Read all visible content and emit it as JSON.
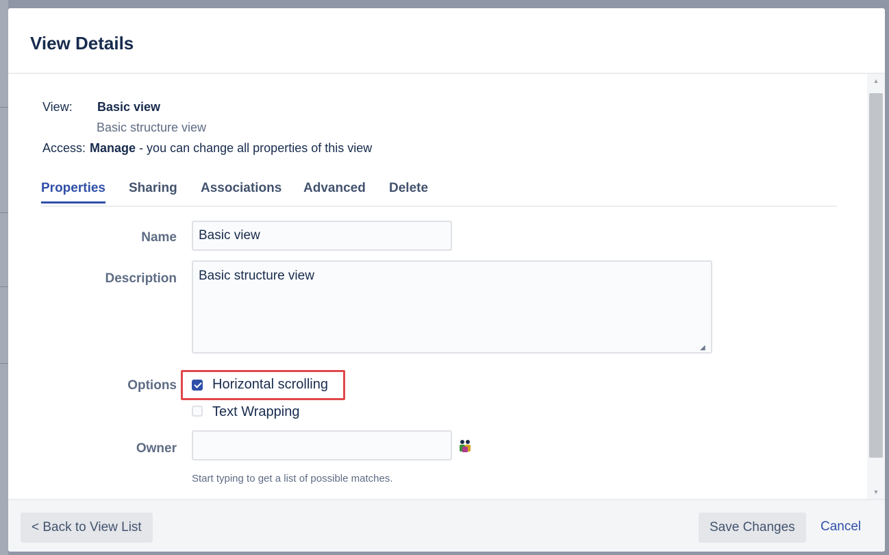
{
  "dialog": {
    "title": "View Details"
  },
  "info": {
    "view_label": "View:",
    "view_name": "Basic view",
    "view_description": "Basic structure view",
    "access_label": "Access:",
    "access_level": "Manage",
    "access_text": " - you can change all properties of this view"
  },
  "tabs": [
    {
      "label": "Properties",
      "active": true
    },
    {
      "label": "Sharing"
    },
    {
      "label": "Associations"
    },
    {
      "label": "Advanced"
    },
    {
      "label": "Delete"
    }
  ],
  "form": {
    "name_label": "Name",
    "name_value": "Basic view",
    "description_label": "Description",
    "description_value": "Basic structure view",
    "options_label": "Options",
    "option_horizontal": "Horizontal scrolling",
    "option_horizontal_checked": true,
    "option_wrapping": "Text Wrapping",
    "option_wrapping_checked": false,
    "owner_label": "Owner",
    "owner_value": "",
    "owner_hint": "Start typing to get a list of possible matches."
  },
  "footer": {
    "back_label": "< Back to View List",
    "save_label": "Save Changes",
    "cancel_label": "Cancel"
  },
  "icons": {
    "owner_picker": "user-picker-icon",
    "scroll_up": "scroll-up-arrow-icon",
    "scroll_down": "scroll-down-arrow-icon"
  },
  "colors": {
    "accent": "#2f4fa8",
    "highlight": "#e0484a"
  }
}
